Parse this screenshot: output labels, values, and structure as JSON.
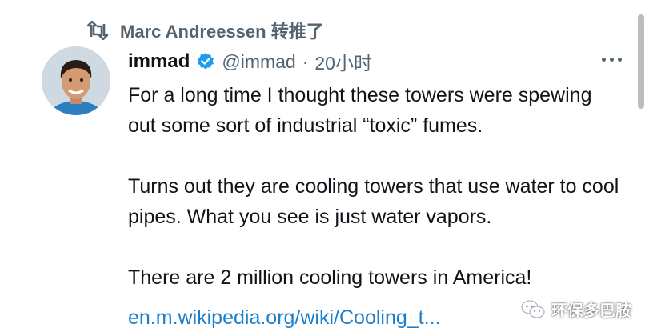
{
  "retweet": {
    "icon": "retweet-icon",
    "text": "Marc Andreessen 转推了"
  },
  "tweet": {
    "author_name": "immad",
    "verified_icon": "verified-badge-icon",
    "handle": "@immad",
    "separator": "·",
    "time": "20小时",
    "more_icon": "more-options-icon",
    "paragraphs": [
      "For a long time I thought these towers were spewing out some sort of industrial “toxic” fumes.",
      "Turns out they are cooling towers that use water to cool pipes. What you see is just water vapors.",
      "There are 2 million cooling towers in America!"
    ],
    "link": "en.m.wikipedia.org/wiki/Cooling_t..."
  },
  "watermark": {
    "icon": "wechat-icon",
    "text": "环保多巴胺"
  },
  "colors": {
    "accent": "#1d9bf0",
    "link": "#1d7fc9",
    "secondary_text": "#536471",
    "primary_text": "#0f1419"
  }
}
